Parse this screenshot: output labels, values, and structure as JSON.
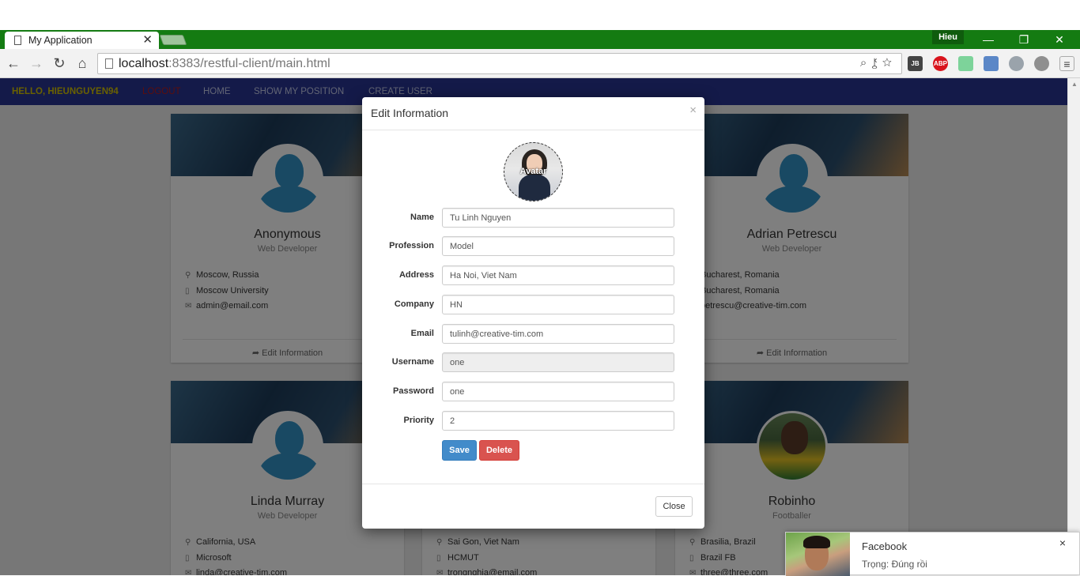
{
  "browser": {
    "tab_title": "My Application",
    "tab_close": "✕",
    "profile": "Hieu",
    "url_host": "localhost",
    "url_rest": ":8383/restful-client/main.html",
    "ext_jb": "JB",
    "ext_abp": "ABP"
  },
  "nav": {
    "brand": "HELLO, HIEUNGUYEN94",
    "logout": "LOGOUT",
    "links": [
      "HOME",
      "SHOW MY POSITION",
      "CREATE USER"
    ]
  },
  "cards": [
    {
      "name": "Anonymous",
      "role": "Web Developer",
      "location": "Moscow, Russia",
      "company": "Moscow University",
      "email": "admin@email.com",
      "edit": "Edit Information"
    },
    {
      "name": "Adrian Petrescu",
      "role": "Web Developer",
      "location": "Bucharest, Romania",
      "company": "Bucharest, Romania",
      "email": "petrescu@creative-tim.com",
      "edit": "Edit Information"
    },
    {
      "name": "Linda Murray",
      "role": "Web Developer",
      "location": "California, USA",
      "company": "Microsoft",
      "email": "linda@creative-tim.com"
    },
    {
      "name": "",
      "role": "",
      "location": "Sai Gon, Viet Nam",
      "company": "HCMUT",
      "email": "trongnghia@email.com"
    },
    {
      "name": "Robinho",
      "role": "Footballer",
      "location": "Brasilia, Brazil",
      "company": "Brazil FB",
      "email": "three@three.com"
    }
  ],
  "modal": {
    "title": "Edit Information",
    "close_x": "×",
    "avatar_label": "Avatar",
    "fields": [
      {
        "label": "Name",
        "value": "Tu Linh Nguyen"
      },
      {
        "label": "Profession",
        "value": "Model"
      },
      {
        "label": "Address",
        "value": "Ha Noi, Viet Nam"
      },
      {
        "label": "Company",
        "value": "HN"
      },
      {
        "label": "Email",
        "value": "tulinh@creative-tim.com"
      },
      {
        "label": "Username",
        "value": "one"
      },
      {
        "label": "Password",
        "value": "one"
      },
      {
        "label": "Priority",
        "value": "2"
      }
    ],
    "save": "Save",
    "delete": "Delete",
    "close": "Close"
  },
  "notification": {
    "title": "Facebook",
    "message": "Trọng: Đúng rồi",
    "close": "×"
  },
  "colors": {
    "chrome_frame": "#147b12",
    "app_nav": "#283593",
    "save_button": "#428bca",
    "delete_button": "#d9534f",
    "avatar_placeholder": "#3393c7"
  }
}
